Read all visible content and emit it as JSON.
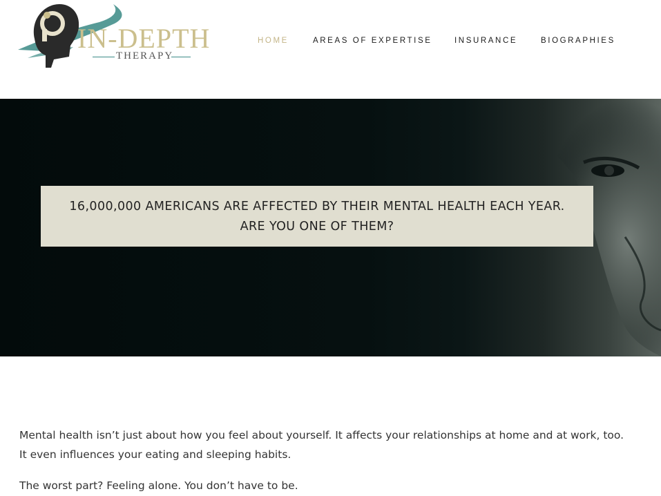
{
  "brand": {
    "mark": "iD",
    "name": "IN-DEPTH",
    "tagline": "THERAPY",
    "colors": {
      "teal": "#3a8a85",
      "gold": "#cbbf8d",
      "dark": "#2a2a2a"
    }
  },
  "nav": {
    "items": [
      {
        "label": "HOME",
        "active": true
      },
      {
        "label": "AREAS OF EXPERTISE",
        "active": false
      },
      {
        "label": "INSURANCE",
        "active": false
      },
      {
        "label": "BIOGRAPHIES",
        "active": false
      }
    ],
    "active_color": "#c4b587"
  },
  "hero": {
    "line1": "16,000,000 AMERICANS ARE AFFECTED BY THEIR MENTAL HEALTH EACH YEAR.",
    "line2": "ARE YOU ONE OF THEM?"
  },
  "content": {
    "p1": "Mental health isn’t just about how you feel about yourself. It affects your relationships at home and at work, too. It even influences your eating and sleeping habits.",
    "p2": "The worst part? Feeling alone. You don’t have to be."
  }
}
